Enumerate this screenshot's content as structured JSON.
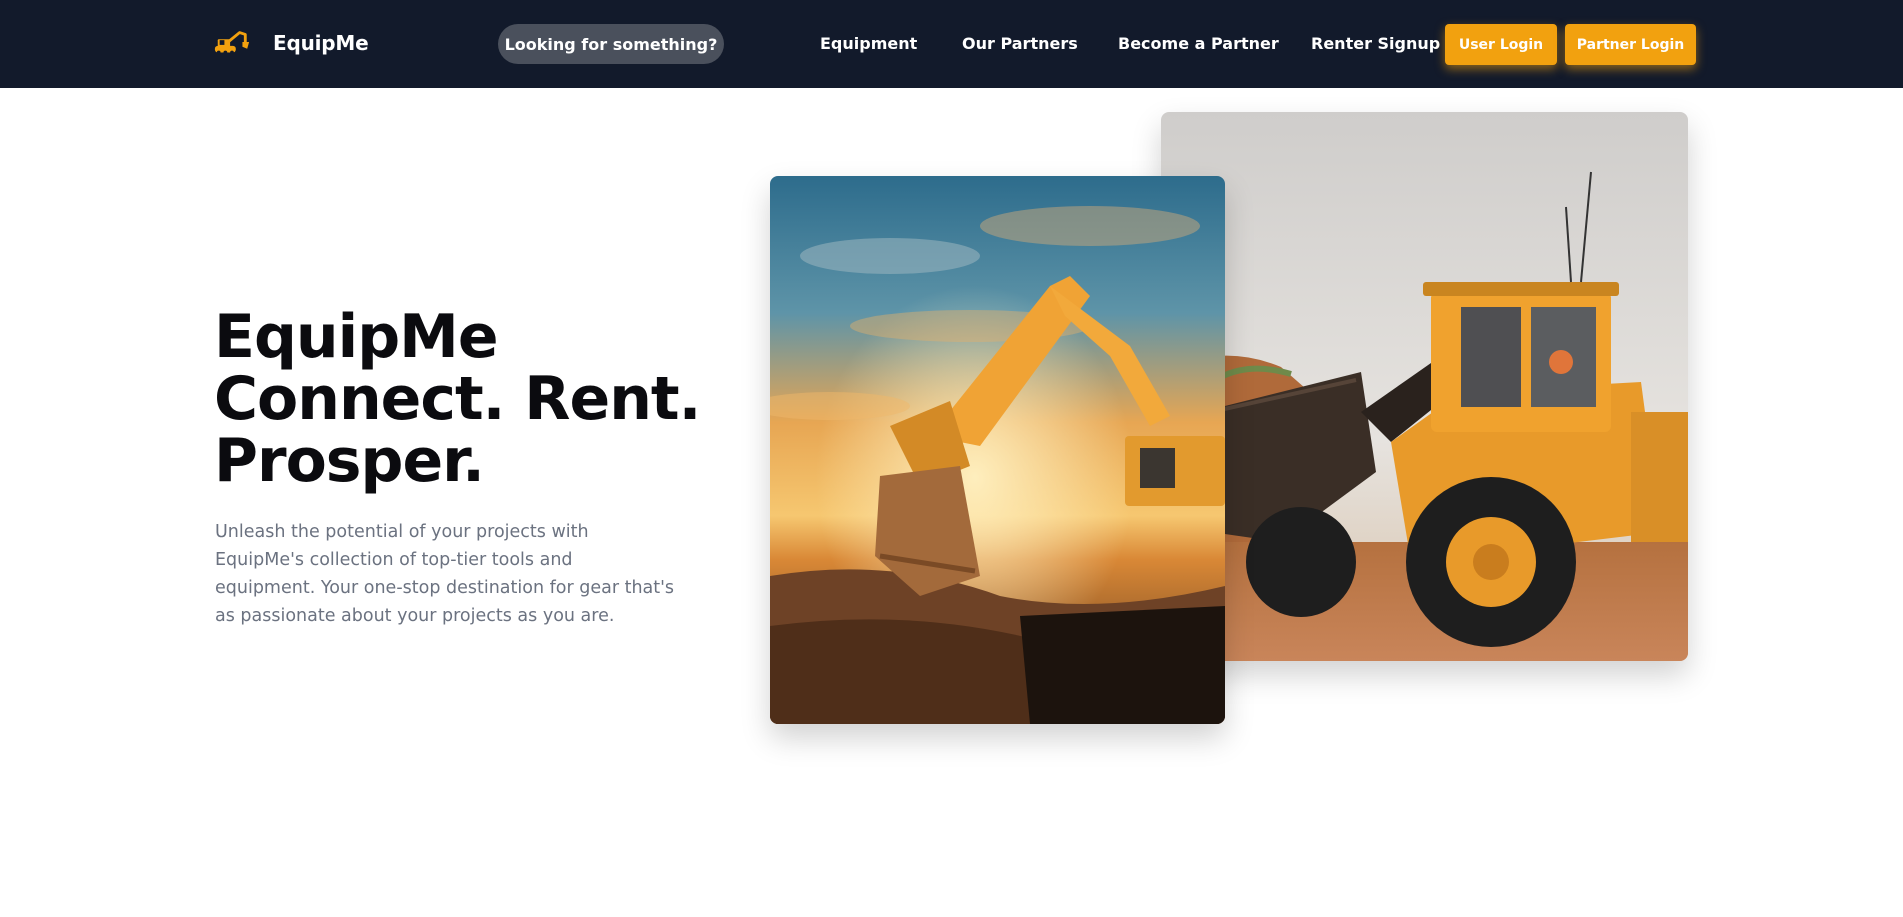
{
  "brand": {
    "name": "EquipMe",
    "logo_icon": "excavator-icon"
  },
  "search": {
    "label": "Looking for something?"
  },
  "nav": {
    "equipment": "Equipment",
    "partners": "Our Partners",
    "become_partner": "Become a Partner",
    "renter_signup": "Renter Signup"
  },
  "buttons": {
    "user_login": "User Login",
    "partner_login": "Partner Login"
  },
  "hero": {
    "title_line1": "EquipMe",
    "title_line2": "Connect. Rent.",
    "title_line3": "Prosper.",
    "description": "Unleash the potential of your projects with EquipMe's collection of top-tier tools and equipment. Your one-stop destination for gear that's as passionate about your projects as you are."
  },
  "colors": {
    "nav_bg": "#121a2b",
    "accent": "#f2a10f",
    "search_pill": "#4a505c"
  }
}
